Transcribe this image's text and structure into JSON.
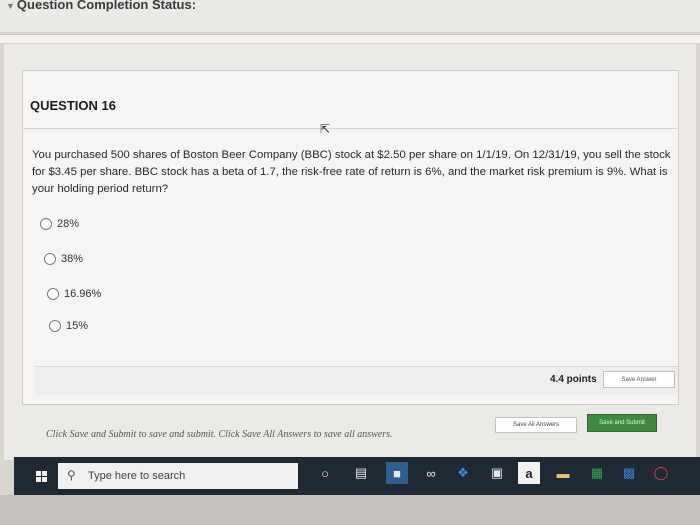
{
  "header": {
    "status_label": "Question Completion Status:",
    "chevron_icon": "chevron-down-icon"
  },
  "question": {
    "number_label": "QUESTION 16",
    "text": "You purchased 500 shares of Boston Beer Company (BBC) stock at $2.50 per share on 1/1/19. On 12/31/19, you sell the stock for $3.45 per share. BBC stock has a beta of 1.7, the risk-free rate of return is 6%, and the market risk premium is 9%. What is your holding period return?",
    "options": [
      "28%",
      "38%",
      "16.96%",
      "15%"
    ],
    "points": "4.4 points",
    "save_answer_label": "Save Answer"
  },
  "footer": {
    "instruction": "Click Save and Submit to save and submit. Click Save All Answers to save all answers.",
    "save_all_label": "Save All Answers",
    "save_submit_label": "Save and Submit"
  },
  "taskbar": {
    "search_placeholder": "Type here to search",
    "icons": [
      "windows-icon",
      "search-icon",
      "cortana-icon",
      "task-view-icon",
      "store-icon",
      "infinity-icon",
      "dropbox-icon",
      "shopping-bag-icon",
      "amazon-icon",
      "folder-icon",
      "excel-icon",
      "explorer-icon",
      "opera-icon"
    ]
  }
}
